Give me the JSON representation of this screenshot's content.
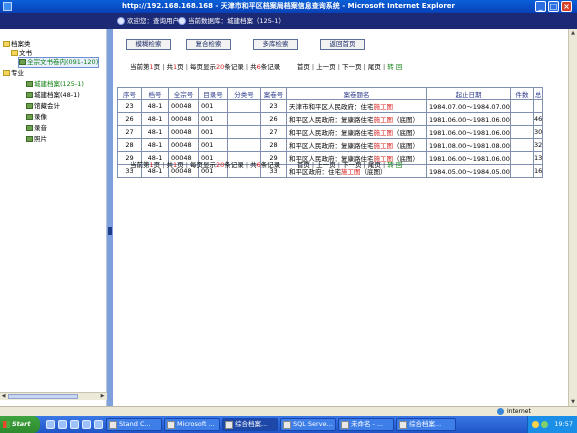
{
  "window": {
    "title": "http://192.168.168.168 - 天津市和平区档案局档案信息查询系统 - Microsoft Internet Explorer"
  },
  "header": {
    "welcome": "欢迎您：查询用户",
    "current_db": "当前数据库：城建档案（125-1）"
  },
  "tree": {
    "root": "档案类",
    "wenshu": "文书",
    "wenshu_child": "全宗文书卷内(091-120)",
    "zhuanye": "专业",
    "items": [
      "城建档案(125-1)",
      "城建档案(48-1)",
      "会计",
      "录像",
      "录音",
      "照片"
    ],
    "items_prefix": [
      "城建档案(125-1)",
      "城建档案(48-1)",
      "馆藏会计",
      "录像",
      "录音",
      "照片"
    ]
  },
  "toolbar": {
    "btn1": "模糊检索",
    "btn2": "复合检索",
    "btn3": "多库检索",
    "btn4": "返回首页"
  },
  "pager": {
    "prefix_cur": "当前第",
    "cur": "1",
    "suffix_cur": "页",
    "prefix_total": "共",
    "total": "1",
    "suffix_total": "页",
    "per_page_prefix": "每页显示",
    "per_page": "20",
    "per_page_suffix": "条记录",
    "rec_prefix": "共",
    "records": "6",
    "rec_suffix": "条记录",
    "first": "首页",
    "prev": "上一页",
    "next": "下一页",
    "last": "尾页",
    "go": "转",
    "reset": "回"
  },
  "table": {
    "headers": [
      "序号",
      "档号",
      "全宗号",
      "目录号",
      "分类号",
      "案卷号",
      "案卷题名",
      "起止日期",
      "件数",
      "总"
    ],
    "rows": [
      {
        "seq": "23",
        "dh": "48-1",
        "qz": "00048",
        "ml": "001",
        "fl": "",
        "aj": "23",
        "title_a": "天津市和平区人民政府：住宅",
        "title_hl": "施工图",
        "title_b": "",
        "date": "1984.07.00～1984.07.00",
        "js": "",
        "z": ""
      },
      {
        "seq": "26",
        "dh": "48-1",
        "qz": "00048",
        "ml": "001",
        "fl": "",
        "aj": "26",
        "title_a": "和平区人民政府：复康路住宅",
        "title_hl": "施工图",
        "title_b": "（底图）",
        "date": "1981.06.00～1981.06.00",
        "js": "",
        "z": "46"
      },
      {
        "seq": "27",
        "dh": "48-1",
        "qz": "00048",
        "ml": "001",
        "fl": "",
        "aj": "27",
        "title_a": "和平区人民政府：复康路住宅",
        "title_hl": "施工图",
        "title_b": "（底图）",
        "date": "1981.06.00～1981.06.00",
        "js": "",
        "z": "30"
      },
      {
        "seq": "28",
        "dh": "48-1",
        "qz": "00048",
        "ml": "001",
        "fl": "",
        "aj": "28",
        "title_a": "和平区人民政府：复康路住宅",
        "title_hl": "施工图",
        "title_b": "（底图）",
        "date": "1981.08.00～1981.08.00",
        "js": "",
        "z": "32"
      },
      {
        "seq": "29",
        "dh": "48-1",
        "qz": "00048",
        "ml": "001",
        "fl": "",
        "aj": "29",
        "title_a": "和平区人民政府：复康路住宅",
        "title_hl": "施工图",
        "title_b": "（底图）",
        "date": "1981.06.00～1981.06.00",
        "js": "",
        "z": "13"
      },
      {
        "seq": "33",
        "dh": "48-1",
        "qz": "00048",
        "ml": "001",
        "fl": "",
        "aj": "33",
        "title_a": "和平区政府：住宅",
        "title_hl": "施工图",
        "title_b": "（底图）",
        "date": "1984.05.00～1984.05.00",
        "js": "",
        "z": "16"
      }
    ]
  },
  "status": {
    "zone": "Internet"
  },
  "taskbar": {
    "start": "Start",
    "tasks": [
      "Stand C...",
      "Microsoft ...",
      "综合档案...",
      "SQL Serve...",
      "未命名 - ...",
      "综合档案..."
    ],
    "clock": "19:57"
  },
  "colors": {
    "title_bar": "#0a5fd8",
    "header": "#1c2a76",
    "highlight": "#d81e1e",
    "link_green": "#108010"
  }
}
